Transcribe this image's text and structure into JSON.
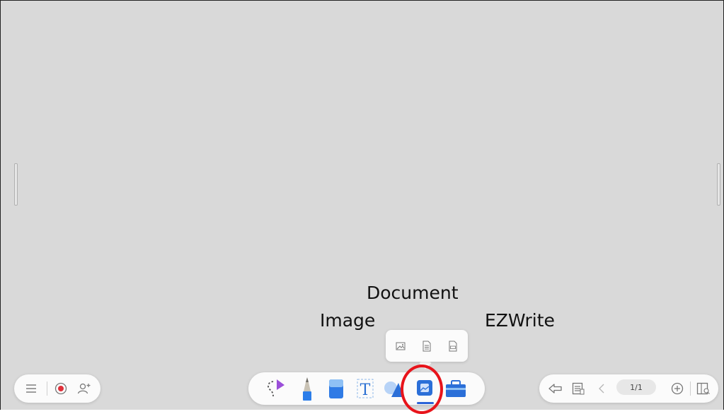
{
  "annotations": {
    "document": "Document",
    "image": "Image",
    "ezwrite": "EZWrite"
  },
  "colors": {
    "canvas": "#d9d9d9",
    "toolbar": "#fbfbfb",
    "highlight_ring": "#e8141b",
    "active_tool": "#2d64d8"
  },
  "left_toolbar": {
    "icons": [
      "menu-icon",
      "record-icon",
      "add-user-icon"
    ]
  },
  "main_toolbar": {
    "tools": [
      "lasso-select-icon",
      "pen-icon",
      "eraser-icon",
      "text-icon",
      "shapes-icon",
      "insert-media-icon",
      "toolbox-icon"
    ],
    "active_tool": "insert-media-icon"
  },
  "insert_popup": {
    "options": [
      "insert-image-icon",
      "insert-document-icon",
      "insert-ezwrite-icon"
    ]
  },
  "right_toolbar": {
    "page_indicator": "1/1",
    "icons": [
      "back-icon",
      "page-settings-icon",
      "previous-page-icon",
      "add-page-icon",
      "page-overview-icon"
    ]
  }
}
